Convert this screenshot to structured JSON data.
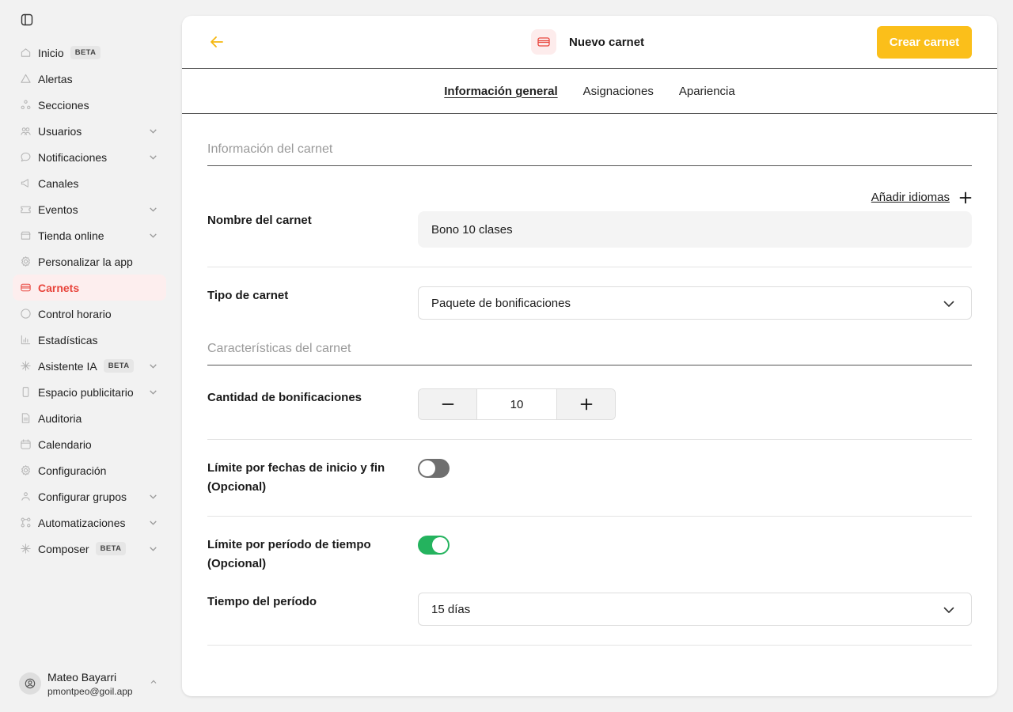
{
  "sidebar": {
    "items": [
      {
        "label": "Inicio",
        "icon": "home-icon",
        "badge": "BETA"
      },
      {
        "label": "Alertas",
        "icon": "alert-icon"
      },
      {
        "label": "Secciones",
        "icon": "sections-icon"
      },
      {
        "label": "Usuarios",
        "icon": "users-icon",
        "expandable": true
      },
      {
        "label": "Notificaciones",
        "icon": "chat-bubble-icon",
        "expandable": true
      },
      {
        "label": "Canales",
        "icon": "megaphone-icon"
      },
      {
        "label": "Eventos",
        "icon": "ticket-icon",
        "expandable": true
      },
      {
        "label": "Tienda online",
        "icon": "shop-icon",
        "expandable": true
      },
      {
        "label": "Personalizar la app",
        "icon": "gear-icon"
      },
      {
        "label": "Carnets",
        "icon": "card-icon",
        "active": true
      },
      {
        "label": "Control horario",
        "icon": "clock-icon"
      },
      {
        "label": "Estadísticas",
        "icon": "bar-chart-icon"
      },
      {
        "label": "Asistente IA",
        "icon": "sparkle-icon",
        "badge": "BETA",
        "expandable": true
      },
      {
        "label": "Espacio publicitario",
        "icon": "phone-icon",
        "expandable": true
      },
      {
        "label": "Auditoria",
        "icon": "document-icon"
      },
      {
        "label": "Calendario",
        "icon": "calendar-icon"
      },
      {
        "label": "Configuración",
        "icon": "gear-icon"
      },
      {
        "label": "Configurar grupos",
        "icon": "group-icon",
        "expandable": true
      },
      {
        "label": "Automatizaciones",
        "icon": "automation-icon",
        "expandable": true
      },
      {
        "label": "Composer",
        "icon": "sparkle-icon",
        "badge": "BETA",
        "expandable": true
      }
    ],
    "user": {
      "name": "Mateo Bayarri",
      "email": "pmontpeo@goil.app"
    }
  },
  "header": {
    "title": "Nuevo carnet",
    "create_label": "Crear carnet"
  },
  "tabs": [
    {
      "label": "Información general",
      "active": true
    },
    {
      "label": "Asignaciones"
    },
    {
      "label": "Apariencia"
    }
  ],
  "form": {
    "section_info": "Información del carnet",
    "add_languages": "Añadir idiomas",
    "name_label": "Nombre del carnet",
    "name_value": "Bono 10 clases",
    "type_label": "Tipo de carnet",
    "type_value": "Paquete de bonificaciones",
    "section_features": "Características del carnet",
    "quantity_label": "Cantidad de bonificaciones",
    "quantity_value": "10",
    "date_limit_label": "Límite por fechas de inicio y fin (Opcional)",
    "date_limit_enabled": false,
    "period_limit_label": "Límite por período de tiempo (Opcional)",
    "period_limit_enabled": true,
    "period_time_label": "Tiempo del período",
    "period_time_value": "15 días"
  },
  "colors": {
    "accent_yellow": "#fbbf1a",
    "active_red": "#e8453c",
    "toggle_on": "#24b35e",
    "toggle_off": "#6f6f6f"
  }
}
